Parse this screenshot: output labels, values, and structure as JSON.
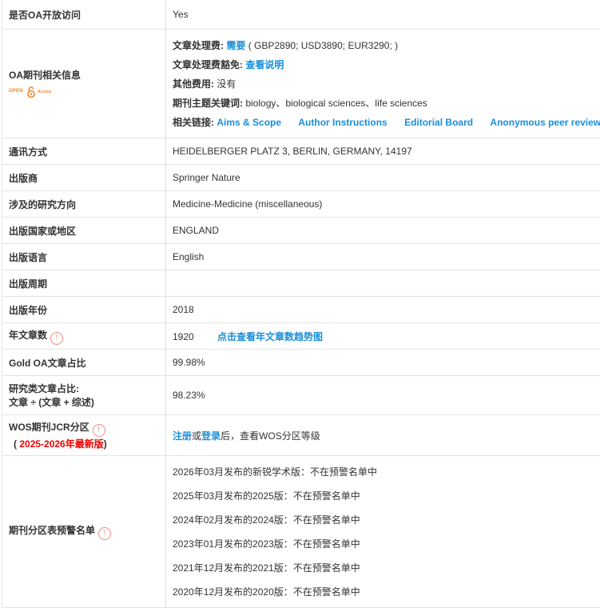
{
  "rows": {
    "oa_open": {
      "label": "是否OA开放访问",
      "value": "Yes"
    },
    "oa_info": {
      "label": "OA期刊相关信息",
      "logo_text_left": "OPEN",
      "logo_text_right": "Access",
      "apc_label": "文章处理费:",
      "apc_value": "需要",
      "apc_detail": "( GBP2890; USD3890; EUR3290; )",
      "waiver_label": "文章处理费豁免:",
      "waiver_link": "查看说明",
      "other_label": "其他费用:",
      "other_value": "没有",
      "keywords_label": "期刊主题关键词:",
      "keywords_value": "biology、biological sciences、life sciences",
      "links_label": "相关链接:",
      "links": [
        "Aims & Scope",
        "Author Instructions",
        "Editorial Board",
        "Anonymous peer review"
      ]
    },
    "contact": {
      "label": "通讯方式",
      "value": "HEIDELBERGER PLATZ 3, BERLIN, GERMANY, 14197"
    },
    "publisher": {
      "label": "出版商",
      "value": "Springer Nature"
    },
    "research": {
      "label": "涉及的研究方向",
      "value": "Medicine-Medicine (miscellaneous)"
    },
    "country": {
      "label": "出版国家或地区",
      "value": "ENGLAND"
    },
    "language": {
      "label": "出版语言",
      "value": "English"
    },
    "frequency": {
      "label": "出版周期",
      "value": ""
    },
    "year": {
      "label": "出版年份",
      "value": "2018"
    },
    "annual": {
      "label": "年文章数",
      "value": "1920",
      "link": "点击查看年文章数趋势图",
      "warn_icon": "!"
    },
    "gold_oa": {
      "label": "Gold OA文章占比",
      "value": "99.98%"
    },
    "research_ratio": {
      "label_line1": "研究类文章占比:",
      "label_line2": "文章 ÷ (文章 + 综述)",
      "value": "98.23%"
    },
    "wos": {
      "label_line1": "WOS期刊JCR分区",
      "label_paren_open": "( ",
      "label_red": "2025-2026年最新版",
      "label_paren_close": ")",
      "register": "注册",
      "or": "或",
      "login": "登录",
      "suffix": "后，查看WOS分区等级",
      "warn_icon": "!"
    },
    "warning_list": {
      "label": "期刊分区表预警名单",
      "warn_icon": "!",
      "items": [
        "2026年03月发布的新锐学术版：不在预警名单中",
        "2025年03月发布的2025版：不在预警名单中",
        "2024年02月发布的2024版：不在预警名单中",
        "2023年01月发布的2023版：不在预警名单中",
        "2021年12月发布的2021版：不在预警名单中",
        "2020年12月发布的2020版：不在预警名单中"
      ]
    }
  }
}
